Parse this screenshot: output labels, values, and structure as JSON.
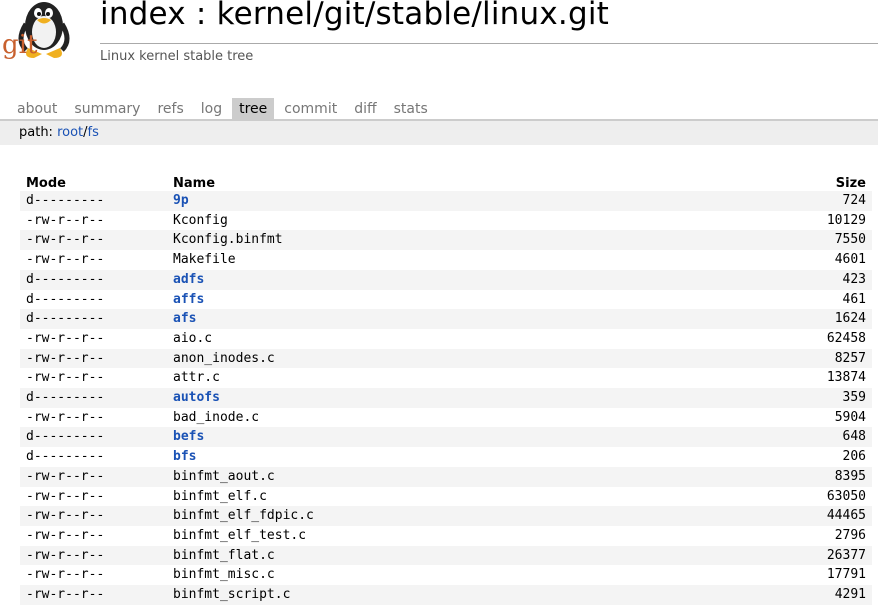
{
  "header": {
    "logo_text": "git",
    "title": "index : kernel/git/stable/linux.git",
    "description": "Linux kernel stable tree"
  },
  "tabs": [
    {
      "label": "about",
      "active": false
    },
    {
      "label": "summary",
      "active": false
    },
    {
      "label": "refs",
      "active": false
    },
    {
      "label": "log",
      "active": false
    },
    {
      "label": "tree",
      "active": true
    },
    {
      "label": "commit",
      "active": false
    },
    {
      "label": "diff",
      "active": false
    },
    {
      "label": "stats",
      "active": false
    }
  ],
  "path": {
    "label": "path: ",
    "root": "root",
    "separator": "/",
    "current": "fs"
  },
  "columns": {
    "mode": "Mode",
    "name": "Name",
    "size": "Size"
  },
  "entries": [
    {
      "mode": "d---------",
      "name": "9p",
      "size": "724",
      "type": "dir"
    },
    {
      "mode": "-rw-r--r--",
      "name": "Kconfig",
      "size": "10129",
      "type": "file"
    },
    {
      "mode": "-rw-r--r--",
      "name": "Kconfig.binfmt",
      "size": "7550",
      "type": "file"
    },
    {
      "mode": "-rw-r--r--",
      "name": "Makefile",
      "size": "4601",
      "type": "file"
    },
    {
      "mode": "d---------",
      "name": "adfs",
      "size": "423",
      "type": "dir"
    },
    {
      "mode": "d---------",
      "name": "affs",
      "size": "461",
      "type": "dir"
    },
    {
      "mode": "d---------",
      "name": "afs",
      "size": "1624",
      "type": "dir"
    },
    {
      "mode": "-rw-r--r--",
      "name": "aio.c",
      "size": "62458",
      "type": "file"
    },
    {
      "mode": "-rw-r--r--",
      "name": "anon_inodes.c",
      "size": "8257",
      "type": "file"
    },
    {
      "mode": "-rw-r--r--",
      "name": "attr.c",
      "size": "13874",
      "type": "file"
    },
    {
      "mode": "d---------",
      "name": "autofs",
      "size": "359",
      "type": "dir"
    },
    {
      "mode": "-rw-r--r--",
      "name": "bad_inode.c",
      "size": "5904",
      "type": "file"
    },
    {
      "mode": "d---------",
      "name": "befs",
      "size": "648",
      "type": "dir"
    },
    {
      "mode": "d---------",
      "name": "bfs",
      "size": "206",
      "type": "dir"
    },
    {
      "mode": "-rw-r--r--",
      "name": "binfmt_aout.c",
      "size": "8395",
      "type": "file"
    },
    {
      "mode": "-rw-r--r--",
      "name": "binfmt_elf.c",
      "size": "63050",
      "type": "file"
    },
    {
      "mode": "-rw-r--r--",
      "name": "binfmt_elf_fdpic.c",
      "size": "44465",
      "type": "file"
    },
    {
      "mode": "-rw-r--r--",
      "name": "binfmt_elf_test.c",
      "size": "2796",
      "type": "file"
    },
    {
      "mode": "-rw-r--r--",
      "name": "binfmt_flat.c",
      "size": "26377",
      "type": "file"
    },
    {
      "mode": "-rw-r--r--",
      "name": "binfmt_misc.c",
      "size": "17791",
      "type": "file"
    },
    {
      "mode": "-rw-r--r--",
      "name": "binfmt_script.c",
      "size": "4291",
      "type": "file"
    }
  ],
  "colors": {
    "link": "#1a52b5",
    "active_tab": "#cccccc",
    "path_bar": "#eeeeee",
    "logo_text": "#c8602e"
  }
}
